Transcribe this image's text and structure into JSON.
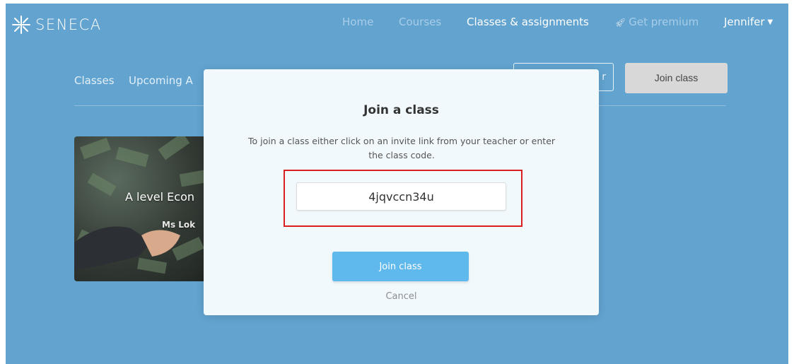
{
  "brand": {
    "name": "SENECA"
  },
  "nav": {
    "home": "Home",
    "courses": "Courses",
    "classes_assignments": "Classes & assignments",
    "get_premium": "Get premium",
    "user_name": "Jennifer"
  },
  "page": {
    "tabs": [
      "Classes",
      "Upcoming A"
    ],
    "create_button_label": "r",
    "join_class_button": "Join class"
  },
  "class_card": {
    "title": "A level Econ",
    "teacher": "Ms Lok"
  },
  "modal": {
    "title": "Join a class",
    "description": "To join a class either click on an invite link from your teacher or enter the class code.",
    "code_value": "4jqvccn34u",
    "join_button": "Join class",
    "cancel": "Cancel"
  },
  "icons": {
    "logo": "seneca-logo-icon",
    "premium": "rocket-icon",
    "user_menu": "caret-down-icon"
  },
  "colors": {
    "background": "#62a3cf",
    "modal_bg": "#f2f9fc",
    "primary_button": "#5fb9ec",
    "highlight": "#d9201f"
  }
}
